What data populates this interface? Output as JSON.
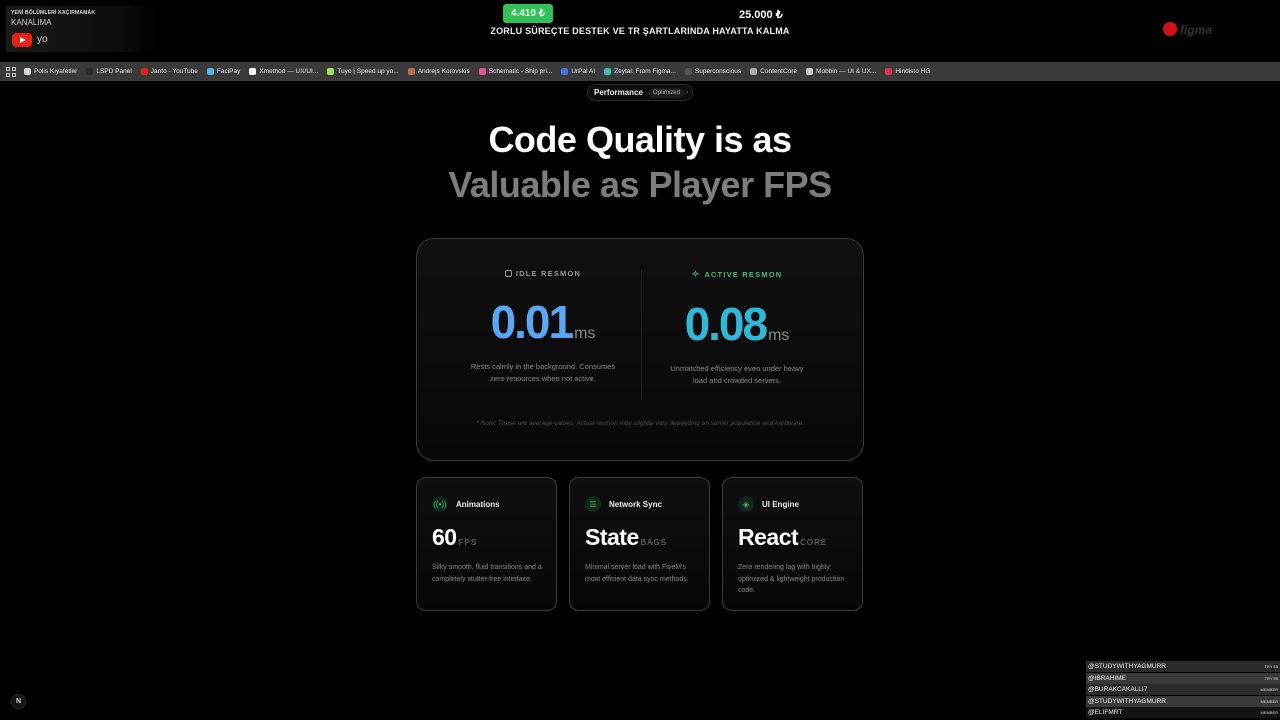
{
  "stream": {
    "yt_small": "YENİ BÖLÜMLERİ KAÇIRMAMAK",
    "yt_channel": "KANALIMA",
    "yt_handle": "yo",
    "goal_current": "4.410 ₺",
    "goal_target": "25.000 ₺",
    "goal_text": "ZORLU SÜREÇTE DESTEK VE TR ŞARTLARINDA HAYATTA KALMA",
    "brand_text": "figma"
  },
  "bookmarks": [
    {
      "label": "Polis Kıyafetler",
      "color": "#d9d9d9"
    },
    {
      "label": "LSPD Panel",
      "color": "#2b2b2b"
    },
    {
      "label": "Janto - YouTube",
      "color": "#e62117"
    },
    {
      "label": "FaciPay",
      "color": "#5ab1e8"
    },
    {
      "label": "Xmethod — UX/UI...",
      "color": "#ffffff"
    },
    {
      "label": "Tuyo | Speed up yo...",
      "color": "#9be35a"
    },
    {
      "label": "Andrejs Korovskis",
      "color": "#c46a4a"
    },
    {
      "label": "Schematic - Ship pri...",
      "color": "#e8528a"
    },
    {
      "label": "UrPal AI",
      "color": "#4a6cf0"
    },
    {
      "label": "Zeytal: From Figma...",
      "color": "#3fbfb0"
    },
    {
      "label": "Superconscious",
      "color": "#555555"
    },
    {
      "label": "ContentCore",
      "color": "#aaaaaa"
    },
    {
      "label": "Mobbin — UI & UX...",
      "color": "#cccccc"
    },
    {
      "label": "Hindisto HG",
      "color": "#e03060"
    }
  ],
  "page": {
    "pill_label": "Performance",
    "pill_tag": "Optimized",
    "pill_chevron": "›",
    "heading_line1": "Code Quality is as",
    "heading_line2": "Valuable as Player FPS",
    "idle": {
      "title": "IDLE RESMON",
      "value": "0.01",
      "unit": "ms",
      "desc": "Rests calmly in the background. Consumes zero resources when not active."
    },
    "active": {
      "title": "ACTIVE RESMON",
      "value": "0.08",
      "unit": "ms",
      "desc": "Unmatched efficiency even under heavy load and crowded servers."
    },
    "note": "* Note: These are average values. Actual resmon may slightly vary depending on server population and hardware.",
    "cards": [
      {
        "title": "Animations",
        "value": "60",
        "unit": "FPS",
        "desc": "Silky smooth, fluid transitions and a completely stutter-free interface."
      },
      {
        "title": "Network Sync",
        "value": "State",
        "unit": "BAGS",
        "desc": "Minimal server load with FiveM's most efficient data sync methods."
      },
      {
        "title": "UI Engine",
        "value": "React",
        "unit": "CORE",
        "desc": "Zero rendering lag with highly optimized & lightweight production code."
      }
    ],
    "next_badge": "N"
  },
  "chat": [
    {
      "user": "@STUDYWITHYAGMURR",
      "tag": "TRY 55"
    },
    {
      "user": "@IBRAHIME",
      "tag": "TRY 55"
    },
    {
      "user": "@BURAKCAKALLI7",
      "tag": "MEMBER"
    },
    {
      "user": "@STUDYWITHYAGMURR",
      "tag": "MEMBER"
    },
    {
      "user": "@ELIFMRT",
      "tag": "MEMBER"
    }
  ]
}
